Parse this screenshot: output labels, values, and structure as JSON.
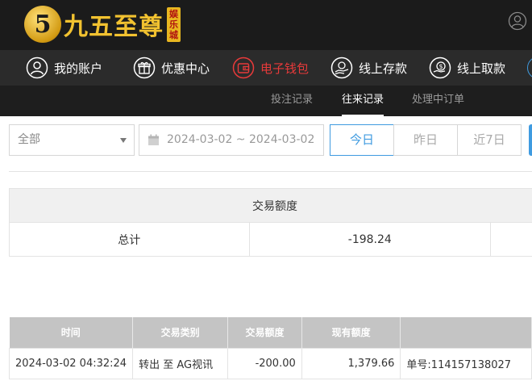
{
  "brand": {
    "logo_mark": "5",
    "name": "九五至尊",
    "tag": "娱乐城"
  },
  "main_nav": [
    {
      "label": "我的账户",
      "icon": "user-circle-icon"
    },
    {
      "label": "优惠中心",
      "icon": "gift-icon"
    },
    {
      "label": "电子钱包",
      "icon": "wallet-icon",
      "active": true
    },
    {
      "label": "线上存款",
      "icon": "deposit-icon"
    },
    {
      "label": "线上取款",
      "icon": "withdraw-icon"
    }
  ],
  "sub_nav": [
    {
      "label": "投注记录"
    },
    {
      "label": "往来记录",
      "active": true
    },
    {
      "label": "处理中订单"
    }
  ],
  "filters": {
    "type_select": "全部",
    "date_range": "2024-03-02 ~ 2024-03-02",
    "quick": [
      "今日",
      "昨日",
      "近7日"
    ]
  },
  "summary": {
    "header": "交易额度",
    "row_label": "总计",
    "row_value": "-198.24"
  },
  "records": {
    "columns": [
      "时间",
      "交易类别",
      "交易额度",
      "现有额度",
      ""
    ],
    "rows": [
      {
        "time": "2024-03-02 04:32:24",
        "type": "转出 至 AG视讯",
        "amount": "-200.00",
        "balance": "1,379.66",
        "note": "单号:114157138027"
      }
    ]
  },
  "colors": {
    "accent_blue": "#3f9be0",
    "active_red": "#e83a3a",
    "logo_gold": "#f2c230"
  }
}
